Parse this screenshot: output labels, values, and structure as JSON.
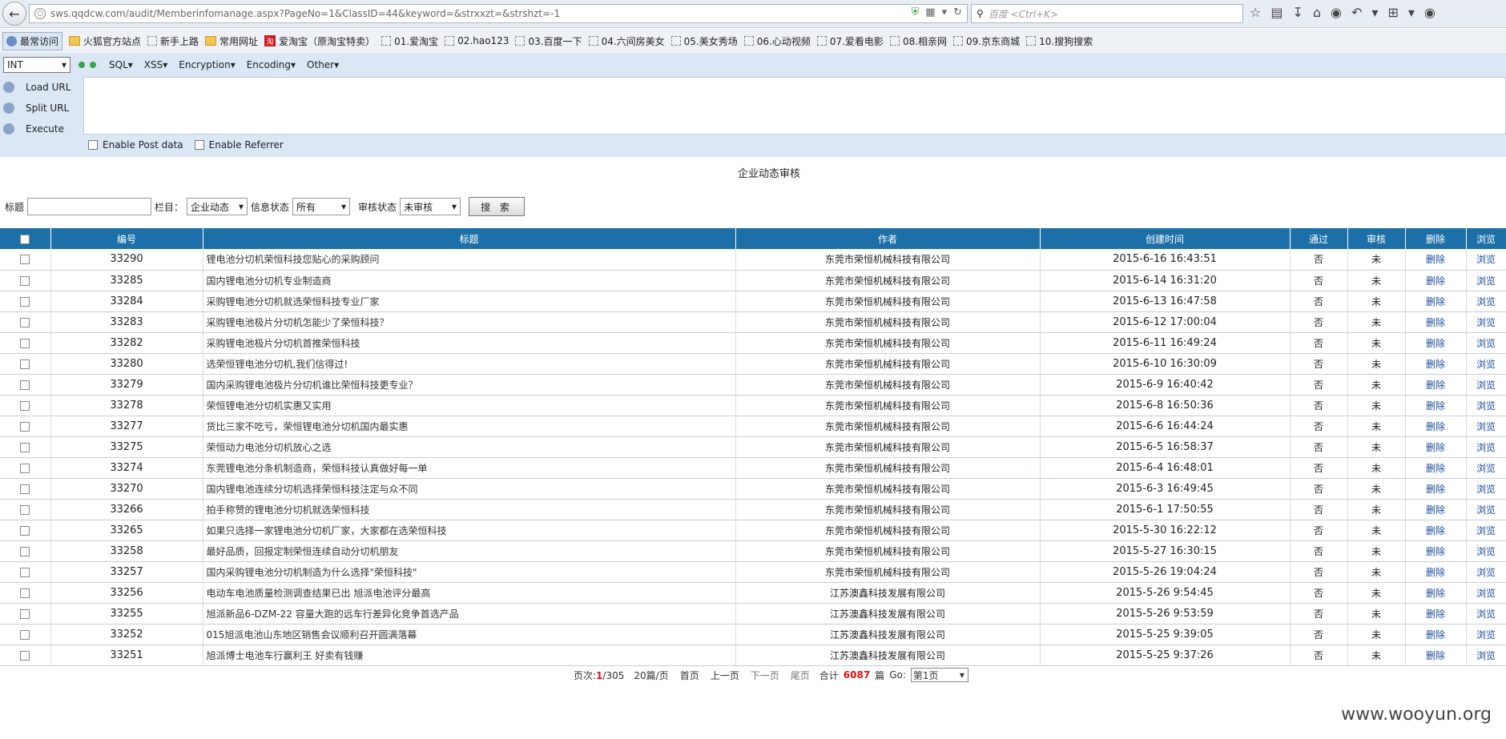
{
  "browser": {
    "url": "sws.qqdcw.com/audit/Memberinfomanage.aspx?PageNo=1&ClassID=44&keyword=&strxxzt=&strshzt=-1",
    "search_placeholder": "百度 <Ctrl+K>"
  },
  "bookmarks": [
    {
      "label": "最常访问",
      "icon": "globe"
    },
    {
      "label": "火狐官方站点",
      "icon": "folder"
    },
    {
      "label": "新手上路",
      "icon": "dot"
    },
    {
      "label": "常用网址",
      "icon": "folder"
    },
    {
      "label": "爱淘宝（原淘宝特卖）",
      "icon": "red"
    },
    {
      "label": "01.爱淘宝",
      "icon": "dot"
    },
    {
      "label": "02.hao123",
      "icon": "dot"
    },
    {
      "label": "03.百度一下",
      "icon": "dot"
    },
    {
      "label": "04.六间房美女",
      "icon": "dot"
    },
    {
      "label": "05.美女秀场",
      "icon": "dot"
    },
    {
      "label": "06.心动视频",
      "icon": "dot"
    },
    {
      "label": "07.爱看电影",
      "icon": "dot"
    },
    {
      "label": "08.相亲网",
      "icon": "dot"
    },
    {
      "label": "09.京东商城",
      "icon": "dot"
    },
    {
      "label": "10.搜狗搜索",
      "icon": "dot"
    }
  ],
  "hackbar": {
    "select_value": "INT",
    "menus": [
      "SQL▾",
      "XSS▾",
      "Encryption▾",
      "Encoding▾",
      "Other▾"
    ],
    "actions": [
      "Load URL",
      "Split URL",
      "Execute"
    ],
    "post_label": "Enable Post data",
    "referrer_label": "Enable Referrer"
  },
  "page": {
    "title": "企业动态审核",
    "filter": {
      "title_label": "标题",
      "column_label": "栏目：",
      "column_value": "企业动态",
      "info_label": "信息状态",
      "info_value": "所有",
      "audit_label": "审核状态",
      "audit_value": "未审核",
      "search_button": "搜 索"
    }
  },
  "table": {
    "headers": [
      "编号",
      "标题",
      "作者",
      "创建时间",
      "通过",
      "审核",
      "删除",
      "浏览"
    ],
    "rows": [
      [
        "33290",
        "锂电池分切机荣恒科技您贴心的采购顾问",
        "东莞市荣恒机械科技有限公司",
        "2015-6-16 16:43:51",
        "否",
        "未",
        "删除",
        "浏览"
      ],
      [
        "33285",
        "国内锂电池分切机专业制造商",
        "东莞市荣恒机械科技有限公司",
        "2015-6-14 16:31:20",
        "否",
        "未",
        "删除",
        "浏览"
      ],
      [
        "33284",
        "采购锂电池分切机就选荣恒科技专业厂家",
        "东莞市荣恒机械科技有限公司",
        "2015-6-13 16:47:58",
        "否",
        "未",
        "删除",
        "浏览"
      ],
      [
        "33283",
        "采购锂电池极片分切机怎能少了荣恒科技？",
        "东莞市荣恒机械科技有限公司",
        "2015-6-12 17:00:04",
        "否",
        "未",
        "删除",
        "浏览"
      ],
      [
        "33282",
        "采购锂电池极片分切机首推荣恒科技",
        "东莞市荣恒机械科技有限公司",
        "2015-6-11 16:49:24",
        "否",
        "未",
        "删除",
        "浏览"
      ],
      [
        "33280",
        "选荣恒锂电池分切机,我们信得过!",
        "东莞市荣恒机械科技有限公司",
        "2015-6-10 16:30:09",
        "否",
        "未",
        "删除",
        "浏览"
      ],
      [
        "33279",
        "国内采购锂电池极片分切机谁比荣恒科技更专业？",
        "东莞市荣恒机械科技有限公司",
        "2015-6-9 16:40:42",
        "否",
        "未",
        "删除",
        "浏览"
      ],
      [
        "33278",
        "荣恒锂电池分切机实惠又实用",
        "东莞市荣恒机械科技有限公司",
        "2015-6-8 16:50:36",
        "否",
        "未",
        "删除",
        "浏览"
      ],
      [
        "33277",
        "货比三家不吃亏，荣恒锂电池分切机国内最实惠",
        "东莞市荣恒机械科技有限公司",
        "2015-6-6 16:44:24",
        "否",
        "未",
        "删除",
        "浏览"
      ],
      [
        "33275",
        "荣恒动力电池分切机放心之选",
        "东莞市荣恒机械科技有限公司",
        "2015-6-5 16:58:37",
        "否",
        "未",
        "删除",
        "浏览"
      ],
      [
        "33274",
        "东莞锂电池分条机制造商，荣恒科技认真做好每一单",
        "东莞市荣恒机械科技有限公司",
        "2015-6-4 16:48:01",
        "否",
        "未",
        "删除",
        "浏览"
      ],
      [
        "33270",
        "国内锂电池连续分切机选择荣恒科技注定与众不同",
        "东莞市荣恒机械科技有限公司",
        "2015-6-3 16:49:45",
        "否",
        "未",
        "删除",
        "浏览"
      ],
      [
        "33266",
        "拍手称赞的锂电池分切机就选荣恒科技",
        "东莞市荣恒机械科技有限公司",
        "2015-6-1 17:50:55",
        "否",
        "未",
        "删除",
        "浏览"
      ],
      [
        "33265",
        "如果只选择一家锂电池分切机厂家，大家都在选荣恒科技",
        "东莞市荣恒机械科技有限公司",
        "2015-5-30 16:22:12",
        "否",
        "未",
        "删除",
        "浏览"
      ],
      [
        "33258",
        "最好品质，回报定制荣恒连续自动分切机朋友",
        "东莞市荣恒机械科技有限公司",
        "2015-5-27 16:30:15",
        "否",
        "未",
        "删除",
        "浏览"
      ],
      [
        "33257",
        "国内采购锂电池分切机制造为什么选择\"荣恒科技\"",
        "东莞市荣恒机械科技有限公司",
        "2015-5-26 19:04:24",
        "否",
        "未",
        "删除",
        "浏览"
      ],
      [
        "33256",
        "电动车电池质量检测调查结果已出 旭派电池评分最高",
        "江苏澳鑫科技发展有限公司",
        "2015-5-26 9:54:45",
        "否",
        "未",
        "删除",
        "浏览"
      ],
      [
        "33255",
        "旭派新品6-DZM-22 容量大跑的远车行差异化竞争首选产品",
        "江苏澳鑫科技发展有限公司",
        "2015-5-26 9:53:59",
        "否",
        "未",
        "删除",
        "浏览"
      ],
      [
        "33252",
        "015旭派电池山东地区销售会议顺利召开圆满落幕",
        "江苏澳鑫科技发展有限公司",
        "2015-5-25 9:39:05",
        "否",
        "未",
        "删除",
        "浏览"
      ],
      [
        "33251",
        "旭派博士电池车行赢利王 好卖有钱赚",
        "江苏澳鑫科技发展有限公司",
        "2015-5-25 9:37:26",
        "否",
        "未",
        "删除",
        "浏览"
      ]
    ]
  },
  "pager": {
    "page_label": "页次:",
    "current": "1",
    "total": "/305",
    "per_page": "20篇/页",
    "first": "首页",
    "prev": "上一页",
    "next": "下一页",
    "last": "尾页",
    "total_label": "合计",
    "count": "6087",
    "count_unit": "篇",
    "go_label": "Go:",
    "go_value": "第1页"
  },
  "watermark": "www.wooyun.org"
}
